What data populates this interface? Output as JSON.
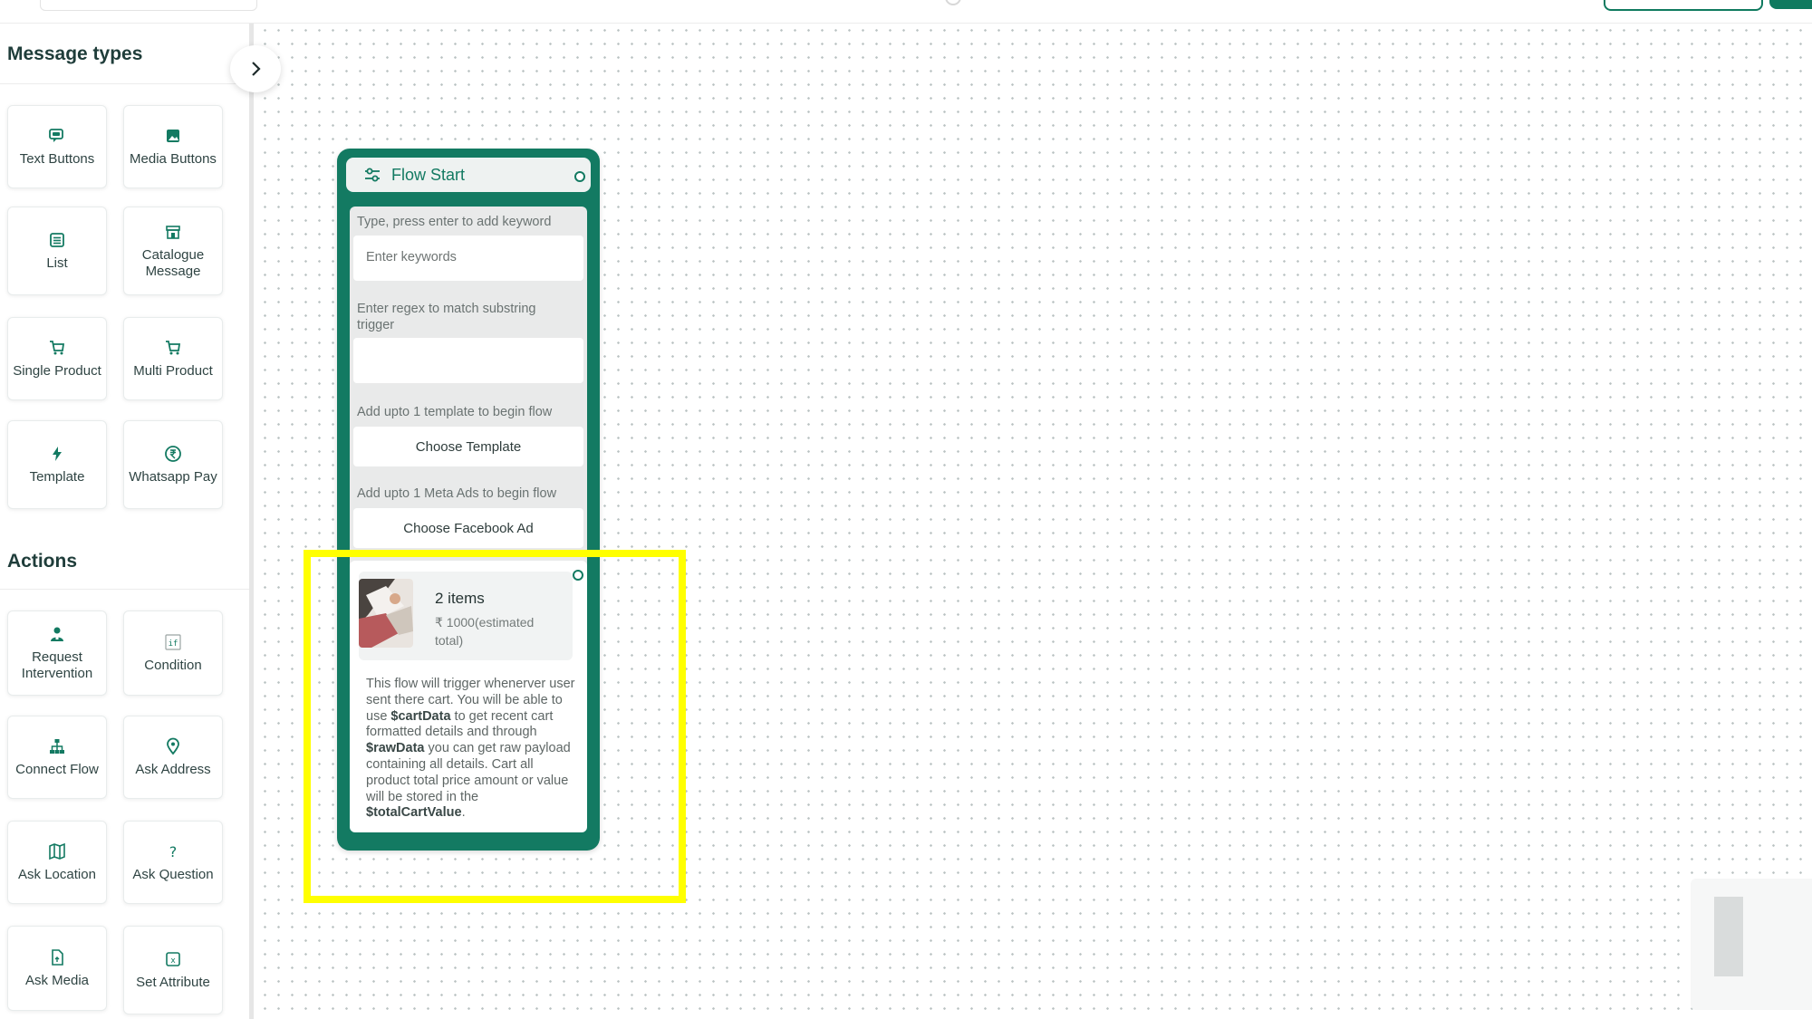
{
  "sidebar": {
    "message_types_title": "Message types",
    "actions_title": "Actions",
    "message_types": [
      {
        "label": "Text Buttons",
        "icon": "chat-bubble-icon"
      },
      {
        "label": "Media Buttons",
        "icon": "image-icon"
      },
      {
        "label": "List",
        "icon": "list-icon"
      },
      {
        "label": "Catalogue Message",
        "icon": "store-icon"
      },
      {
        "label": "Single Product",
        "icon": "cart-icon"
      },
      {
        "label": "Multi Product",
        "icon": "cart-icon"
      },
      {
        "label": "Template",
        "icon": "lightning-icon"
      },
      {
        "label": "Whatsapp Pay",
        "icon": "rupee-circle-icon"
      }
    ],
    "actions": [
      {
        "label": "Request Intervention",
        "icon": "agent-icon"
      },
      {
        "label": "Condition",
        "icon": "if-icon"
      },
      {
        "label": "Connect Flow",
        "icon": "hierarchy-icon"
      },
      {
        "label": "Ask Address",
        "icon": "map-pin-icon"
      },
      {
        "label": "Ask Location",
        "icon": "map-icon"
      },
      {
        "label": "Ask Question",
        "icon": "question-icon"
      },
      {
        "label": "Ask Media",
        "icon": "file-icon"
      },
      {
        "label": "Set Attribute",
        "icon": "variable-icon"
      }
    ]
  },
  "node": {
    "title": "Flow Start",
    "keyword_label": "Type, press enter to add keyword",
    "keyword_placeholder": "Enter keywords",
    "regex_label": "Enter regex to match substring trigger",
    "regex_value": "",
    "template_label": "Add upto 1 template to begin flow",
    "template_button": "Choose Template",
    "ads_label": "Add upto 1 Meta Ads to begin flow",
    "ads_button": "Choose Facebook Ad",
    "cart": {
      "items": "2 items",
      "total": "₹ 1000(estimated total)",
      "desc_1": "This flow will trigger whenerver user sent there cart. You will be able to use ",
      "var_cart": "$cartData",
      "desc_2": " to get recent cart formatted details and through ",
      "var_raw": "$rawData",
      "desc_3": " you can get raw payload containing all details. Cart all product total price amount or value will be stored in the ",
      "var_total": "$totalCartValue",
      "desc_4": "."
    }
  },
  "colors": {
    "brand": "#137a62",
    "highlight": "#ffff00"
  }
}
